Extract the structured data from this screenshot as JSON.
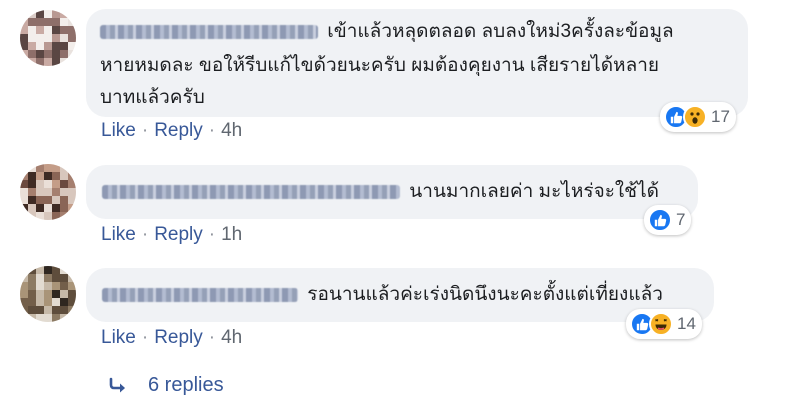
{
  "comments": [
    {
      "line1": "เข้าแล้วหลุดตลอด ลบลงใหม่3ครั้งละข้อมูล",
      "line2": "หายหมดละ ขอให้รีบแก้ไขด้วยนะครับ ผมต้องคุยงาน เสียรายได้หลาย",
      "line3": "บาทแล้วครับ",
      "like": "Like",
      "reply": "Reply",
      "time": "4h",
      "reaction_count": "17",
      "reactions": [
        "like-icon",
        "wow-icon"
      ]
    },
    {
      "text": "นานมากเลยค่า มะไหร่จะใช้ได้",
      "like": "Like",
      "reply": "Reply",
      "time": "1h",
      "reaction_count": "7",
      "reactions": [
        "like-icon"
      ]
    },
    {
      "text": "รอนานแล้วค่ะเร่งนิดนึงนะคะตั้งแต่เที่ยงแล้ว",
      "like": "Like",
      "reply": "Reply",
      "time": "4h",
      "reaction_count": "14",
      "reactions": [
        "like-icon",
        "haha-icon"
      ]
    }
  ],
  "separator": "·",
  "replies_label": "6 replies",
  "colors": {
    "link": "#385898",
    "bubble": "#f0f2f5",
    "like": "#1877f2",
    "emoji": "#f7b125"
  }
}
